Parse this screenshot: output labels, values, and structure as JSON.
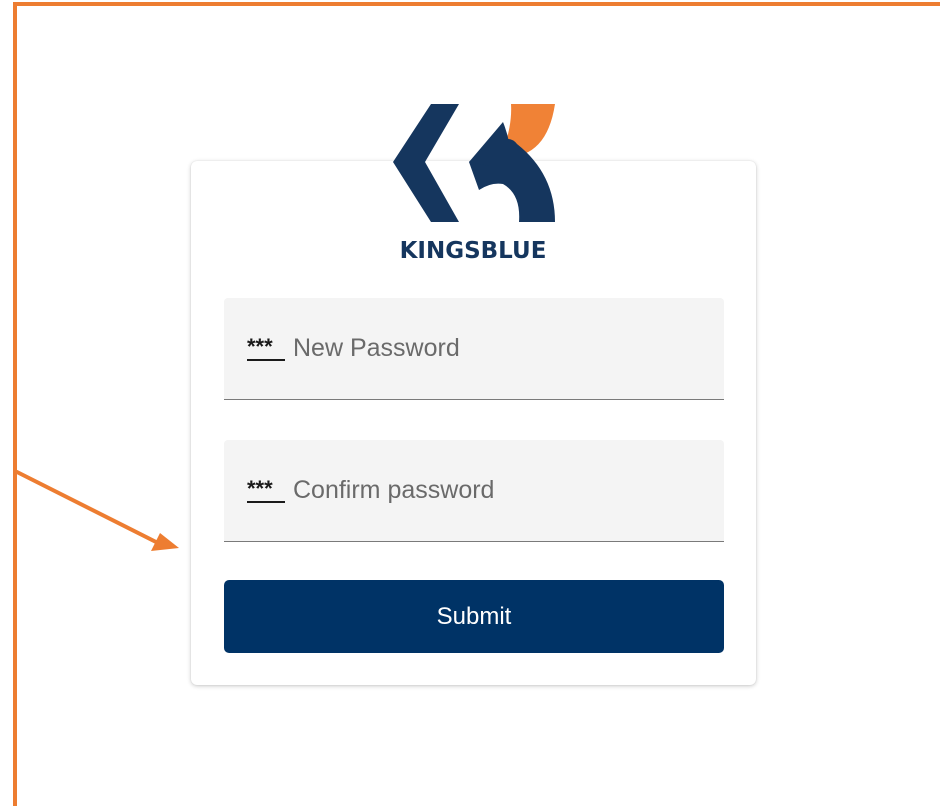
{
  "app": {
    "brand_name": "KINGSBLUE"
  },
  "form": {
    "new_password": {
      "placeholder": "New Password",
      "icon": "password-key-icon"
    },
    "confirm_password": {
      "placeholder": "Confirm password",
      "icon": "password-key-icon"
    },
    "submit_label": "Submit"
  },
  "colors": {
    "brand_navy": "#15365e",
    "brand_orange": "#f08236",
    "button_bg": "#003366",
    "annotation": "#ed7d31"
  }
}
